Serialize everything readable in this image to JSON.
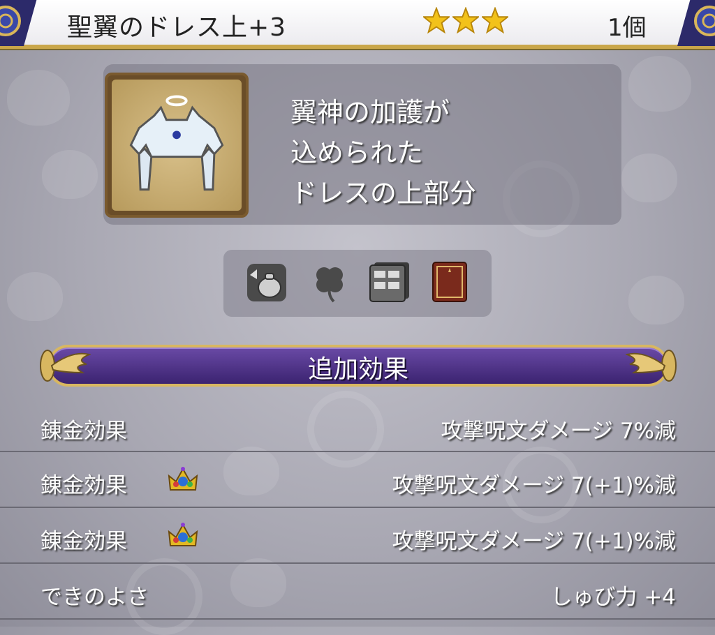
{
  "header": {
    "item_name": "聖翼のドレス上+3",
    "rarity_stars": 3,
    "count": "1個"
  },
  "item": {
    "icon": "dress-top-icon",
    "description_lines": [
      "翼神の加護が",
      "込められた",
      "ドレスの上部分"
    ]
  },
  "icon_bar": {
    "icons": [
      "sell-bag-icon",
      "clover-icon",
      "storage-chest-icon",
      "book-icon"
    ]
  },
  "section": {
    "title": "追加効果"
  },
  "effects": [
    {
      "label": "錬金効果",
      "crown": false,
      "value": "攻撃呪文ダメージ 7%減"
    },
    {
      "label": "錬金効果",
      "crown": true,
      "value": "攻撃呪文ダメージ 7(+1)%減"
    },
    {
      "label": "錬金効果",
      "crown": true,
      "value": "攻撃呪文ダメージ 7(+1)%減"
    },
    {
      "label": "できのよさ",
      "crown": false,
      "value": "しゅび力 +4"
    }
  ],
  "colors": {
    "header_bg": "#ffffff",
    "gold_trim": "#c9a64a",
    "banner_purple": "#4a2e86",
    "background_gray": "#a9a8b3",
    "star_gold": "#f2c21a"
  }
}
